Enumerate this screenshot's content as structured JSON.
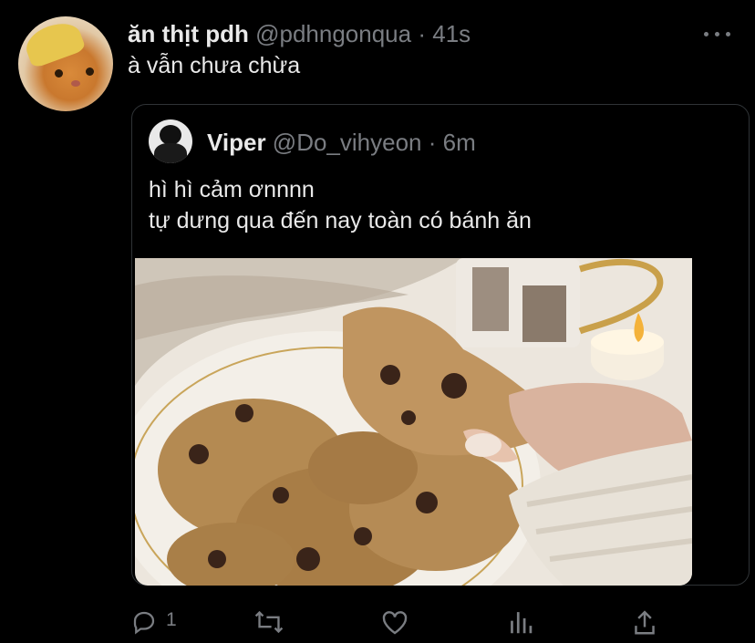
{
  "tweet": {
    "display_name": "ăn thịt pdh",
    "handle": "@pdhngonqua",
    "separator": "·",
    "time": "41s",
    "text": "à vẫn chưa chừa",
    "avatar_icon": "cat-with-banana-peel-avatar"
  },
  "quoted": {
    "display_name": "Viper",
    "handle": "@Do_vihyeon",
    "separator": "·",
    "time": "6m",
    "text": "hì hì cảm ơnnnn\ntự dưng qua đến nay toàn có bánh ăn",
    "avatar_icon": "person-in-black-cap-avatar"
  },
  "actions": {
    "reply_count": "1",
    "icons": [
      "reply-icon",
      "retweet-icon",
      "like-icon",
      "analytics-icon",
      "share-icon"
    ]
  },
  "colors": {
    "background": "#000000",
    "text_primary": "#e9e9e9",
    "text_secondary": "#7a7d82",
    "border": "#2f3336"
  }
}
